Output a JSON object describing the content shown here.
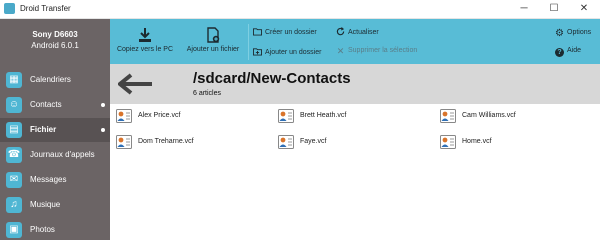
{
  "window": {
    "title": "Droid Transfer"
  },
  "window_controls": {
    "minimize": "─",
    "maximize": "☐",
    "close": "✕"
  },
  "device": {
    "name": "Sony D6603",
    "os": "Android 6.0.1"
  },
  "sidebar": {
    "items": [
      {
        "label": "Calendriers",
        "icon": "calendar-icon",
        "glyph": "▦",
        "active": false,
        "dot": false
      },
      {
        "label": "Contacts",
        "icon": "contacts-icon",
        "glyph": "☺",
        "active": false,
        "dot": true
      },
      {
        "label": "Fichier",
        "icon": "files-icon",
        "glyph": "▤",
        "active": true,
        "dot": true
      },
      {
        "label": "Journaux d'appels",
        "icon": "phone-icon",
        "glyph": "☎",
        "active": false,
        "dot": false
      },
      {
        "label": "Messages",
        "icon": "messages-icon",
        "glyph": "✉",
        "active": false,
        "dot": false
      },
      {
        "label": "Musique",
        "icon": "music-icon",
        "glyph": "♫",
        "active": false,
        "dot": false
      },
      {
        "label": "Photos",
        "icon": "photos-icon",
        "glyph": "▣",
        "active": false,
        "dot": false
      }
    ]
  },
  "toolbar": {
    "copy_to_pc": "Copiez vers le PC",
    "add_file": "Ajouter un fichier",
    "create_folder": "Créer un dossier",
    "add_folder": "Ajouter un dossier",
    "refresh": "Actualiser",
    "delete_selection": "Supprimer la sélection",
    "options": "Options",
    "help": "Aide"
  },
  "location": {
    "path": "/sdcard/New-Contacts",
    "count": "6 articles"
  },
  "files": [
    {
      "name": "Alex Price.vcf"
    },
    {
      "name": "Brett Heath.vcf"
    },
    {
      "name": "Cam Williams.vcf"
    },
    {
      "name": "Dom Treharne.vcf"
    },
    {
      "name": "Faye.vcf"
    },
    {
      "name": "Home.vcf"
    }
  ],
  "colors": {
    "toolbar": "#58bcd6",
    "sidebar": "#6b6465",
    "sidebar_active": "#585253",
    "pathbar": "#d7d7d7",
    "icon_accent": "#4fb6d3"
  }
}
